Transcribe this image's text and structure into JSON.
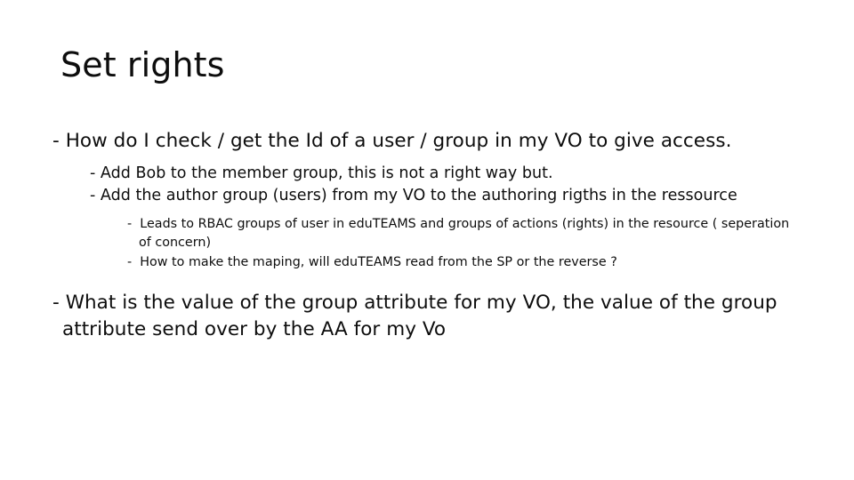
{
  "slide": {
    "title": "Set rights",
    "background_color": "#ffffff",
    "text_color": "#0d0d0d",
    "bullets": [
      {
        "level": 1,
        "text": "- How do I check / get the Id of a user / group in my VO to give access."
      },
      {
        "level": 2,
        "text": "- Add Bob to the member group, this is not a right way but."
      },
      {
        "level": 2,
        "text": "- Add the author group (users) from my VO to the authoring rigths in the ressource"
      },
      {
        "level": 3,
        "text": "-  Leads to RBAC groups of user in eduTEAMS and groups of actions (rights) in the resource ( seperation of concern)"
      },
      {
        "level": 3,
        "text": "-  How to make the maping, will eduTEAMS read from the SP or the reverse ?"
      },
      {
        "level": 1,
        "text": "- What is the value of the group attribute for my VO, the value of the group attribute send over by the AA for my Vo"
      }
    ]
  }
}
